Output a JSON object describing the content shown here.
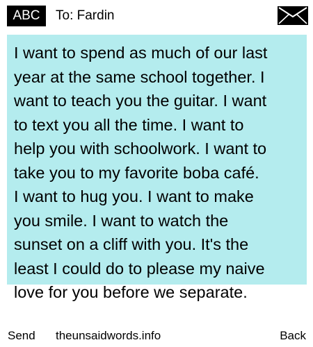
{
  "header": {
    "mode_label": "ABC",
    "recipient": "To: Fardin",
    "envelope_icon": "envelope-icon"
  },
  "message": {
    "text": "I want to spend as much of our last\nyear at the same school together. I\nwant to teach you the guitar. I want\nto text you all the time. I want to\nhelp you with schoolwork. I want to\ntake you to my favorite boba café.\nI want to hug you. I want to make\nyou smile. I want to watch the\nsunset on a cliff with you. It's the\nleast I could do to please my naive\nlove for you before we separate.",
    "highlight_color": "#b4ecee"
  },
  "footer": {
    "send_label": "Send",
    "site": "theunsaidwords.info",
    "back_label": "Back"
  }
}
